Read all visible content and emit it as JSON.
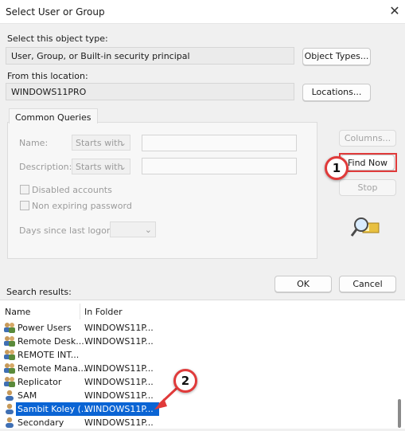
{
  "window": {
    "title": "Select User or Group",
    "close_glyph": "✕"
  },
  "object_type": {
    "label": "Select this object type:",
    "value": "User, Group, or Built-in security principal",
    "button": "Object Types..."
  },
  "location": {
    "label": "From this location:",
    "value": "WINDOWS11PRO",
    "button": "Locations..."
  },
  "common_queries": {
    "tab": "Common Queries",
    "name_label": "Name:",
    "name_mode": "Starts with",
    "description_label": "Description:",
    "description_mode": "Starts with",
    "disabled_accounts": "Disabled accounts",
    "non_expiring_password": "Non expiring password",
    "days_since_logon": "Days since last logon:"
  },
  "side_buttons": {
    "columns": "Columns...",
    "find_now": "Find Now",
    "stop": "Stop"
  },
  "dialog_buttons": {
    "ok": "OK",
    "cancel": "Cancel"
  },
  "search_results": {
    "label": "Search results:",
    "columns": [
      "Name",
      "In Folder"
    ],
    "rows": [
      {
        "name": "Power Users",
        "folder": "WINDOWS11P...",
        "icon": "group-icon"
      },
      {
        "name": "Remote Desk...",
        "folder": "WINDOWS11P...",
        "icon": "group-icon"
      },
      {
        "name": "REMOTE INT...",
        "folder": "",
        "icon": "group-icon"
      },
      {
        "name": "Remote Mana...",
        "folder": "WINDOWS11P...",
        "icon": "group-icon"
      },
      {
        "name": "Replicator",
        "folder": "WINDOWS11P...",
        "icon": "group-icon"
      },
      {
        "name": "SAM",
        "folder": "WINDOWS11P...",
        "icon": "user-icon"
      },
      {
        "name": "Sambit Koley (...",
        "folder": "WINDOWS11P...",
        "icon": "user-icon",
        "selected": true
      },
      {
        "name": "Secondary",
        "folder": "WINDOWS11P...",
        "icon": "user-icon"
      }
    ]
  },
  "annotations": {
    "step1": "1",
    "step2": "2",
    "accent_red": "#e03a3a"
  },
  "colors": {
    "selection": "#0a64d4"
  }
}
